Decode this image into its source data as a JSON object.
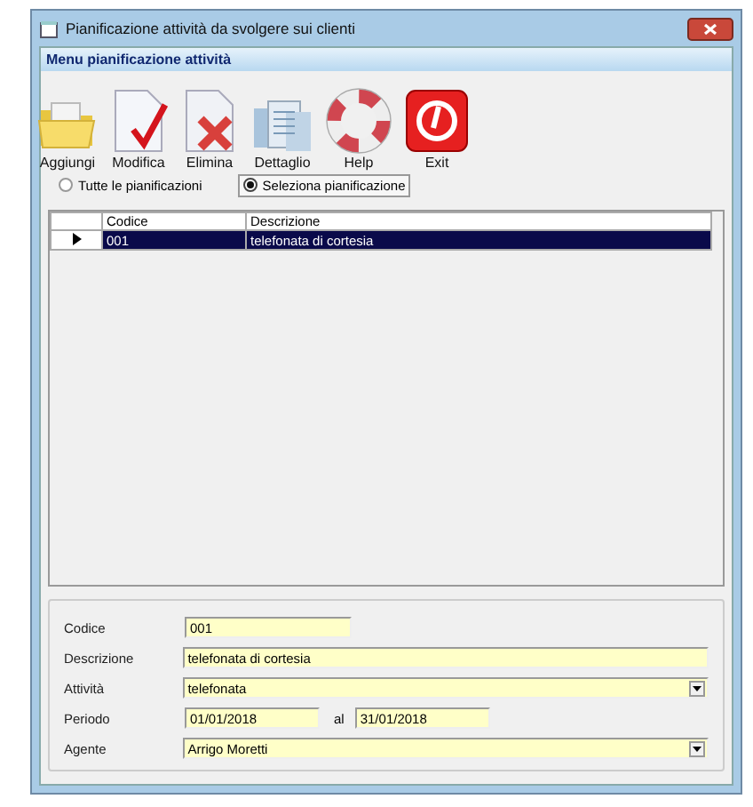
{
  "window": {
    "title": "Pianificazione attività da svolgere sui clienti"
  },
  "menu_bar": {
    "title": "Menu pianificazione attività"
  },
  "toolbar": [
    {
      "kind": "folder",
      "label": "Aggiungi"
    },
    {
      "kind": "edit",
      "label": "Modifica"
    },
    {
      "kind": "delete",
      "label": "Elimina"
    },
    {
      "kind": "detail",
      "label": "Dettaglio"
    },
    {
      "kind": "help",
      "label": "Help"
    },
    {
      "kind": "exit",
      "label": "Exit"
    }
  ],
  "filter": [
    {
      "label": "Tutte le pianificazioni",
      "selected": false
    },
    {
      "label": "Seleziona pianificazione",
      "selected": true
    }
  ],
  "table": {
    "columns": [
      "Codice",
      "Descrizione"
    ],
    "rows": [
      {
        "cells": [
          "001",
          "telefonata di cortesia"
        ],
        "selected": true
      }
    ]
  },
  "form": {
    "fields": [
      {
        "kind": "text",
        "label": "Codice",
        "value": "001"
      },
      {
        "kind": "text",
        "label": "Descrizione",
        "value": "telefonata di cortesia"
      },
      {
        "kind": "dropdown",
        "label": "Attività",
        "value": "telefonata"
      },
      {
        "kind": "range",
        "label": "Periodo",
        "value": "01/01/2018",
        "separator": "al",
        "value_to": "31/01/2018"
      },
      {
        "kind": "dropdown",
        "label": "Agente",
        "value": "Arrigo Moretti"
      }
    ]
  }
}
